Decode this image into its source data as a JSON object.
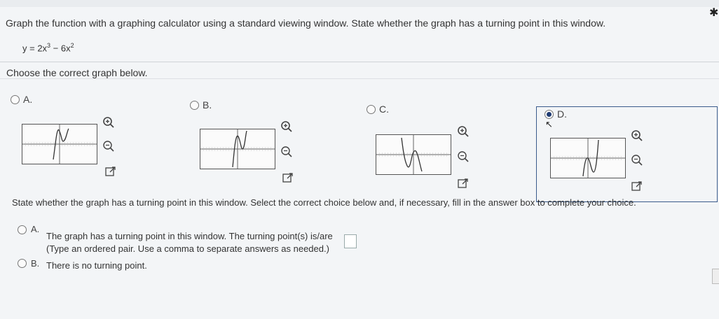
{
  "question": {
    "prompt": "Graph the function with a graphing calculator using a standard viewing window. State whether the graph has a turning point in this window.",
    "function_text": "y = 2x³ − 6x²",
    "choose_text": "Choose the correct graph below."
  },
  "graph_options": [
    {
      "letter": "A.",
      "selected": false
    },
    {
      "letter": "B.",
      "selected": false
    },
    {
      "letter": "C.",
      "selected": false
    },
    {
      "letter": "D.",
      "selected": true
    }
  ],
  "icons": {
    "zoom_in": "zoom-in-icon",
    "zoom_out": "zoom-out-icon",
    "open": "open-external-icon"
  },
  "part2": {
    "prompt": "State whether the graph has a turning point in this window. Select the correct choice below and, if necessary, fill in the answer box to complete your choice.",
    "choice_a_letter": "A.",
    "choice_a_text": "The graph has a turning point in this window. The turning point(s) is/are",
    "choice_a_hint": "(Type an ordered pair. Use a comma to separate answers as needed.)",
    "choice_b_letter": "B.",
    "choice_b_text": "There is no turning point."
  },
  "colors": {
    "selection_border": "#3a5b8c",
    "radio_selected": "#1f3b73"
  }
}
